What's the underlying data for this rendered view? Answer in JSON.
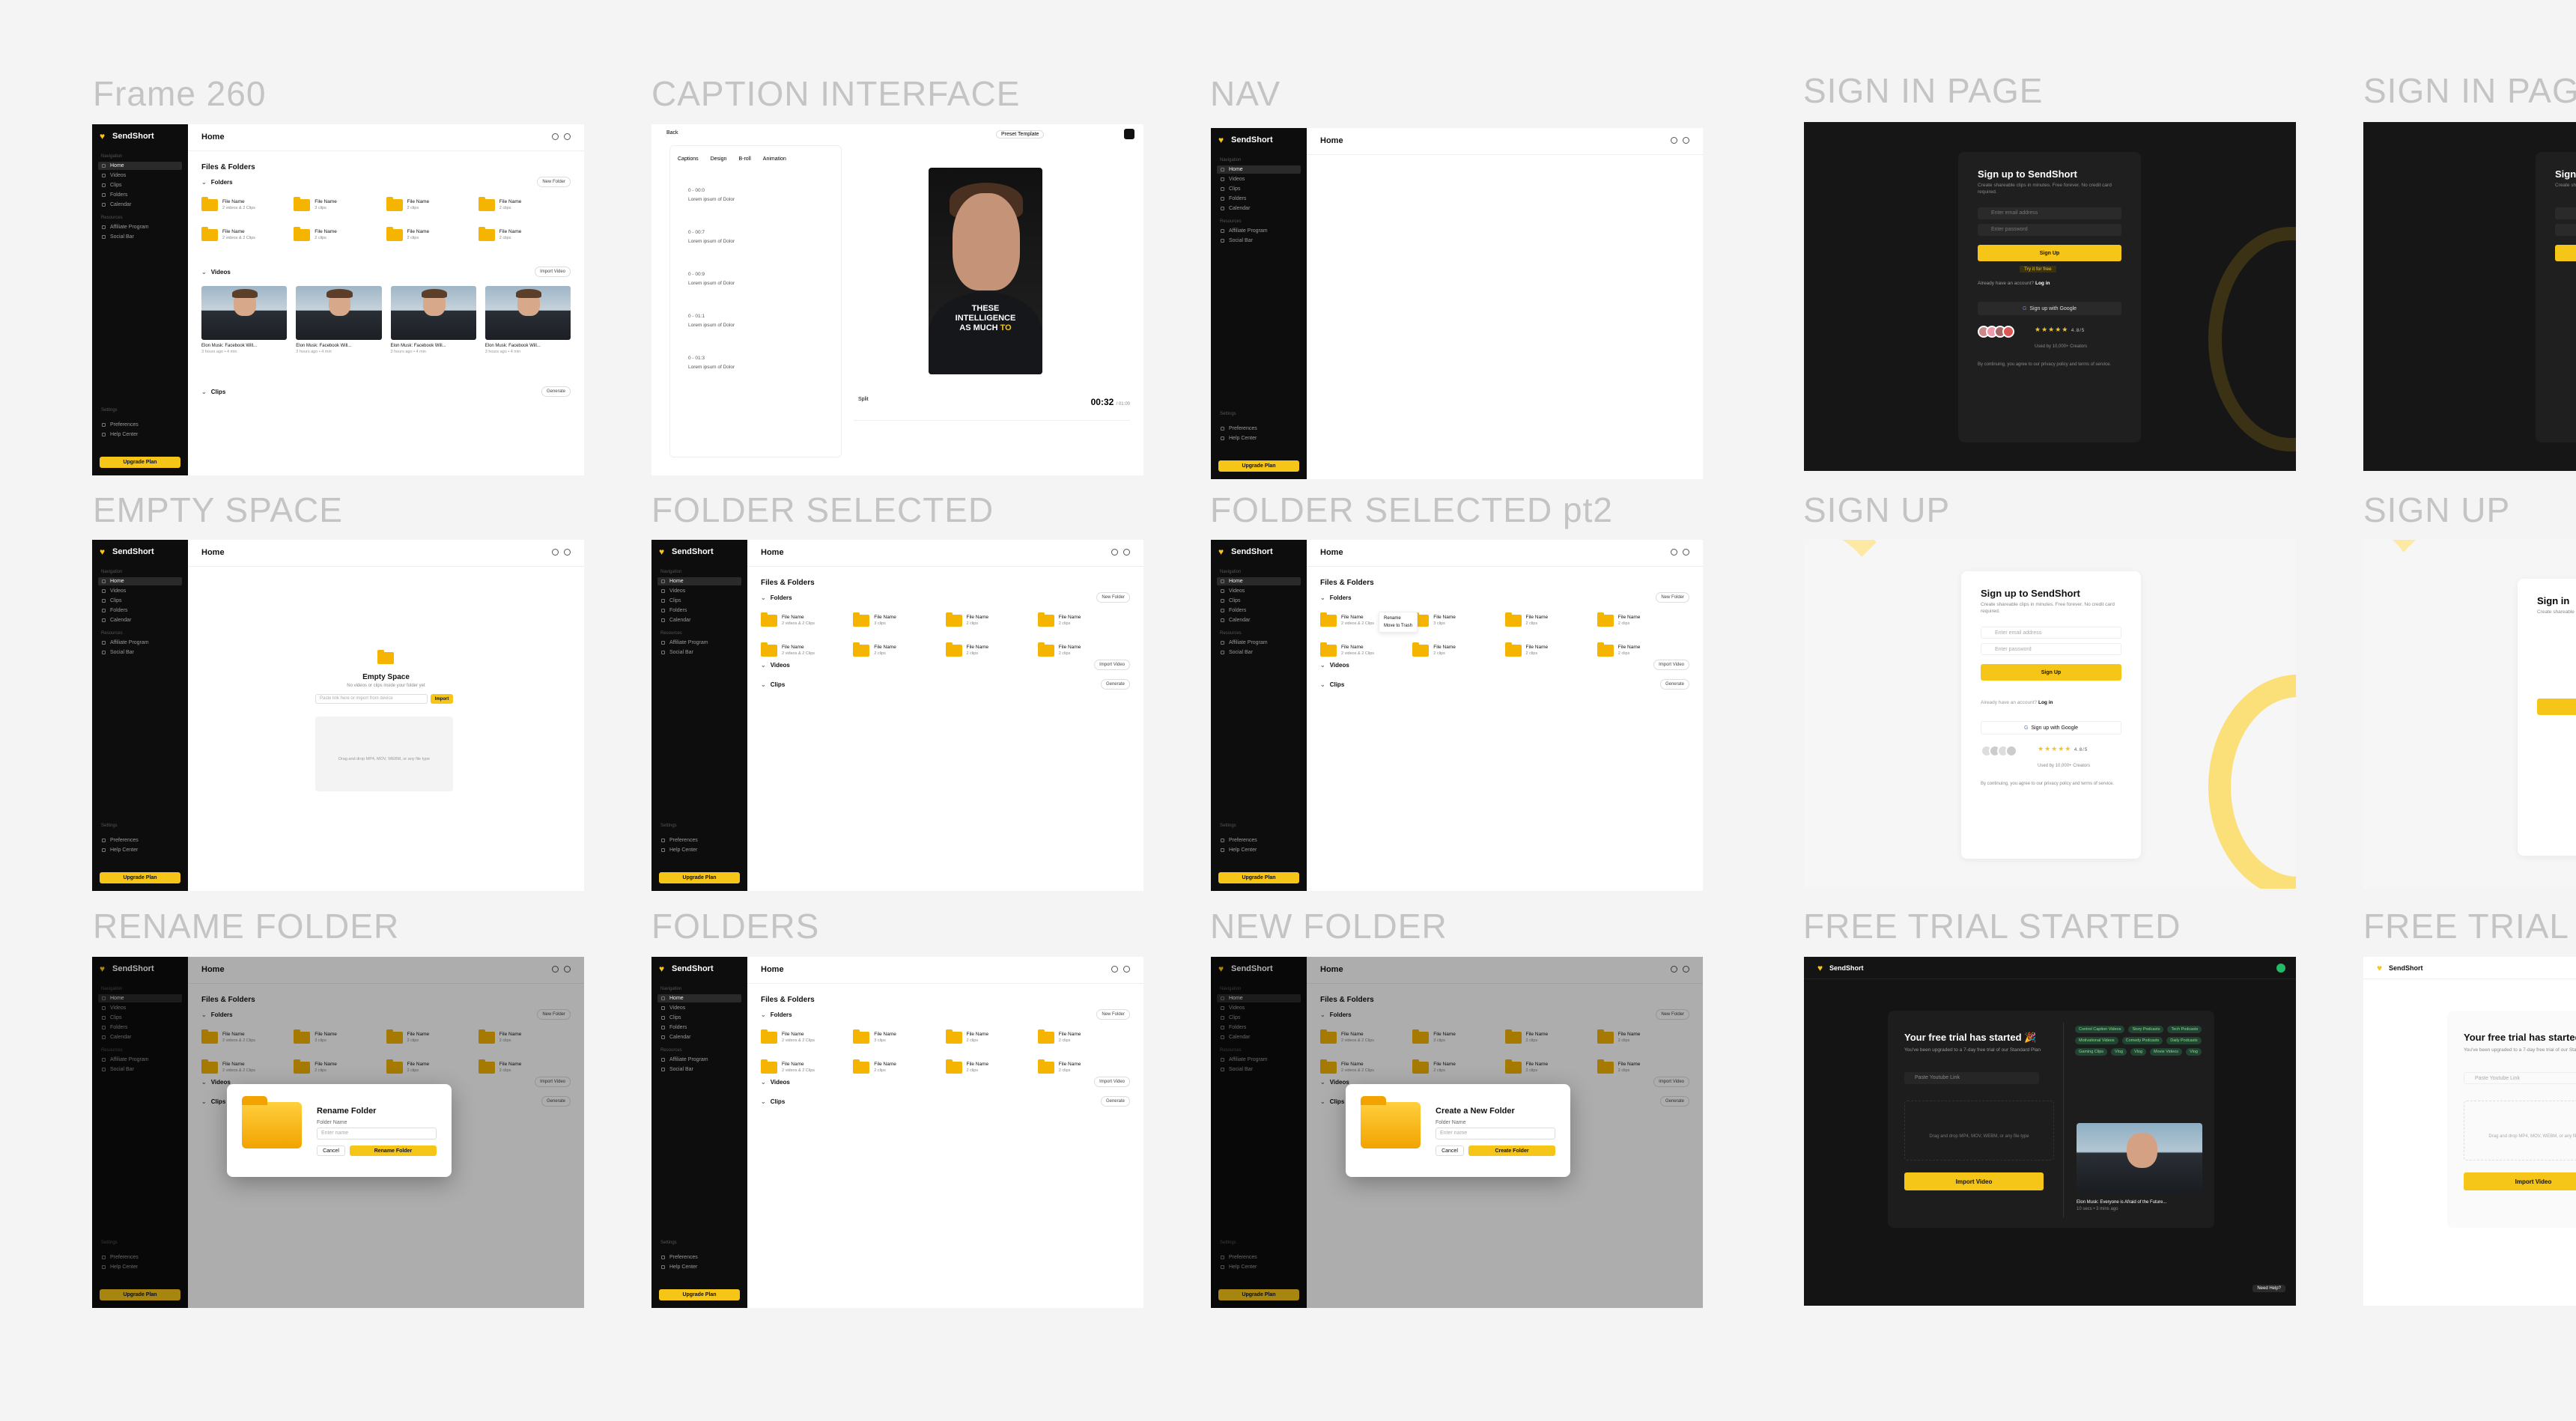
{
  "frames": {
    "frame260": "Frame 260",
    "caption": "CAPTION INTERFACE",
    "nav": "NAV",
    "signin1": "SIGN IN PAGE",
    "signin2": "SIGN IN PAGE",
    "empty": "EMPTY SPACE",
    "folder_selected": "FOLDER SELECTED",
    "folder_selected2": "FOLDER SELECTED pt2",
    "signup1": "SIGN UP",
    "signup2": "SIGN UP",
    "rename": "RENAME FOLDER",
    "folders": "FOLDERS",
    "new_folder": "NEW FOLDER",
    "free_trial1": "FREE TRIAL STARTED",
    "free_trial2": "FREE TRIAL ST"
  },
  "app": {
    "brand": "SendShort",
    "home": "Home",
    "files_folders": "Files & Folders",
    "folders": "Folders",
    "new_folder_btn": "New Folder",
    "videos": "Videos",
    "import_video": "Import Video",
    "clips": "Clips",
    "generate": "Generate",
    "upgrade": "Upgrade Plan",
    "sidebar": {
      "navigation": "Navigation",
      "items": [
        "Home",
        "Videos",
        "Clips",
        "Folders",
        "Calendar"
      ],
      "resources": "Resources",
      "res_items": [
        "Affiliate Program",
        "Social Bar"
      ],
      "settings": "Settings",
      "set_items": [
        "Preferences",
        "Help Center"
      ]
    },
    "folder_items": [
      {
        "name": "File Name",
        "sub": "2 videos & 2 Clips"
      },
      {
        "name": "File Name",
        "sub": "3 clips"
      },
      {
        "name": "File Name",
        "sub": "2 clips"
      },
      {
        "name": "File Name",
        "sub": "2 clips"
      },
      {
        "name": "File Name",
        "sub": "2 videos & 2 Clips"
      },
      {
        "name": "File Name",
        "sub": "2 clips"
      },
      {
        "name": "File Name",
        "sub": "2 clips"
      },
      {
        "name": "File Name",
        "sub": "2 clips"
      }
    ],
    "video_caption": "Elon Musk: Facebook Will...",
    "video_sub": "3 hours ago • 4 min"
  },
  "empty": {
    "title": "Empty Space",
    "sub": "No videos or clips inside your folder yet",
    "placeholder": "Paste link here or import from device",
    "import": "Import",
    "drop": "Drag and drop MP4, MOV, WEBM, or any file type"
  },
  "context_menu": [
    "Rename",
    "Move to Trash"
  ],
  "rename_modal": {
    "title": "Rename Folder",
    "label": "Folder Name",
    "placeholder": "Enter name",
    "cancel": "Cancel",
    "ok": "Rename Folder"
  },
  "new_modal": {
    "title": "Create a New Folder",
    "label": "Folder Name",
    "placeholder": "Enter name",
    "cancel": "Cancel",
    "ok": "Create Folder"
  },
  "caption": {
    "back": "Back",
    "preset": "Preset Template",
    "tabs": [
      "Captions",
      "Design",
      "B-roll",
      "Animation"
    ],
    "lines": [
      "0 - 00:0",
      "Lorem ipsum of Dolor",
      "0 - 00:7",
      "Lorem ipsum of Dolor",
      "0 - 00:9",
      "Lorem ipsum of Dolor",
      "0 - 01:1",
      "Lorem ipsum of Dolor",
      "0 - 01:3",
      "Lorem ipsum of Dolor"
    ],
    "video_text_1": "THESE",
    "video_text_2": "INTELLIGENCE",
    "video_text_3": "AS MUCH",
    "video_text_y": "TO",
    "time": "00:32",
    "time_sub": "/ 01:00",
    "split": "Split"
  },
  "signup": {
    "title": "Sign up to SendShort",
    "sub": "Create shareable clips in minutes. Free forever. No credit card required.",
    "email": "Enter email address",
    "password": "Enter password",
    "btn": "Sign Up",
    "free": "Try it for free",
    "already": "Already have an account?",
    "login": "Log in",
    "google": "Sign up with Google",
    "rating": "4.8/5",
    "rating_sub": "Used by 10,000+ Creators",
    "terms": "By continuing, you agree to our privacy policy and terms of service."
  },
  "signin": {
    "title": "Sign in",
    "sub": "Create shareable clips in minutes"
  },
  "trial": {
    "title": "Your free trial has started 🎉",
    "sub": "You've been upgraded to a 7-day free trial of our Standard Plan",
    "input": "Paste Youtube Link",
    "drop": "Drag and drop MP4, MOV, WEBM, or any file type",
    "import": "Import Video",
    "chips": [
      "Control Caption Videos",
      "Story Podcasts",
      "Tech Podcasts",
      "Motivational Videos",
      "Comedy Podcasts",
      "Daily Podcasts",
      "Gaming Clips",
      "Vlog",
      "Vlog",
      "Movie Videos",
      "Vlog"
    ],
    "video_title": "Elon Musk: Everyone is Afraid of the Future...",
    "video_sub": "10 secs • 3 mins ago",
    "help": "Need Help?"
  }
}
